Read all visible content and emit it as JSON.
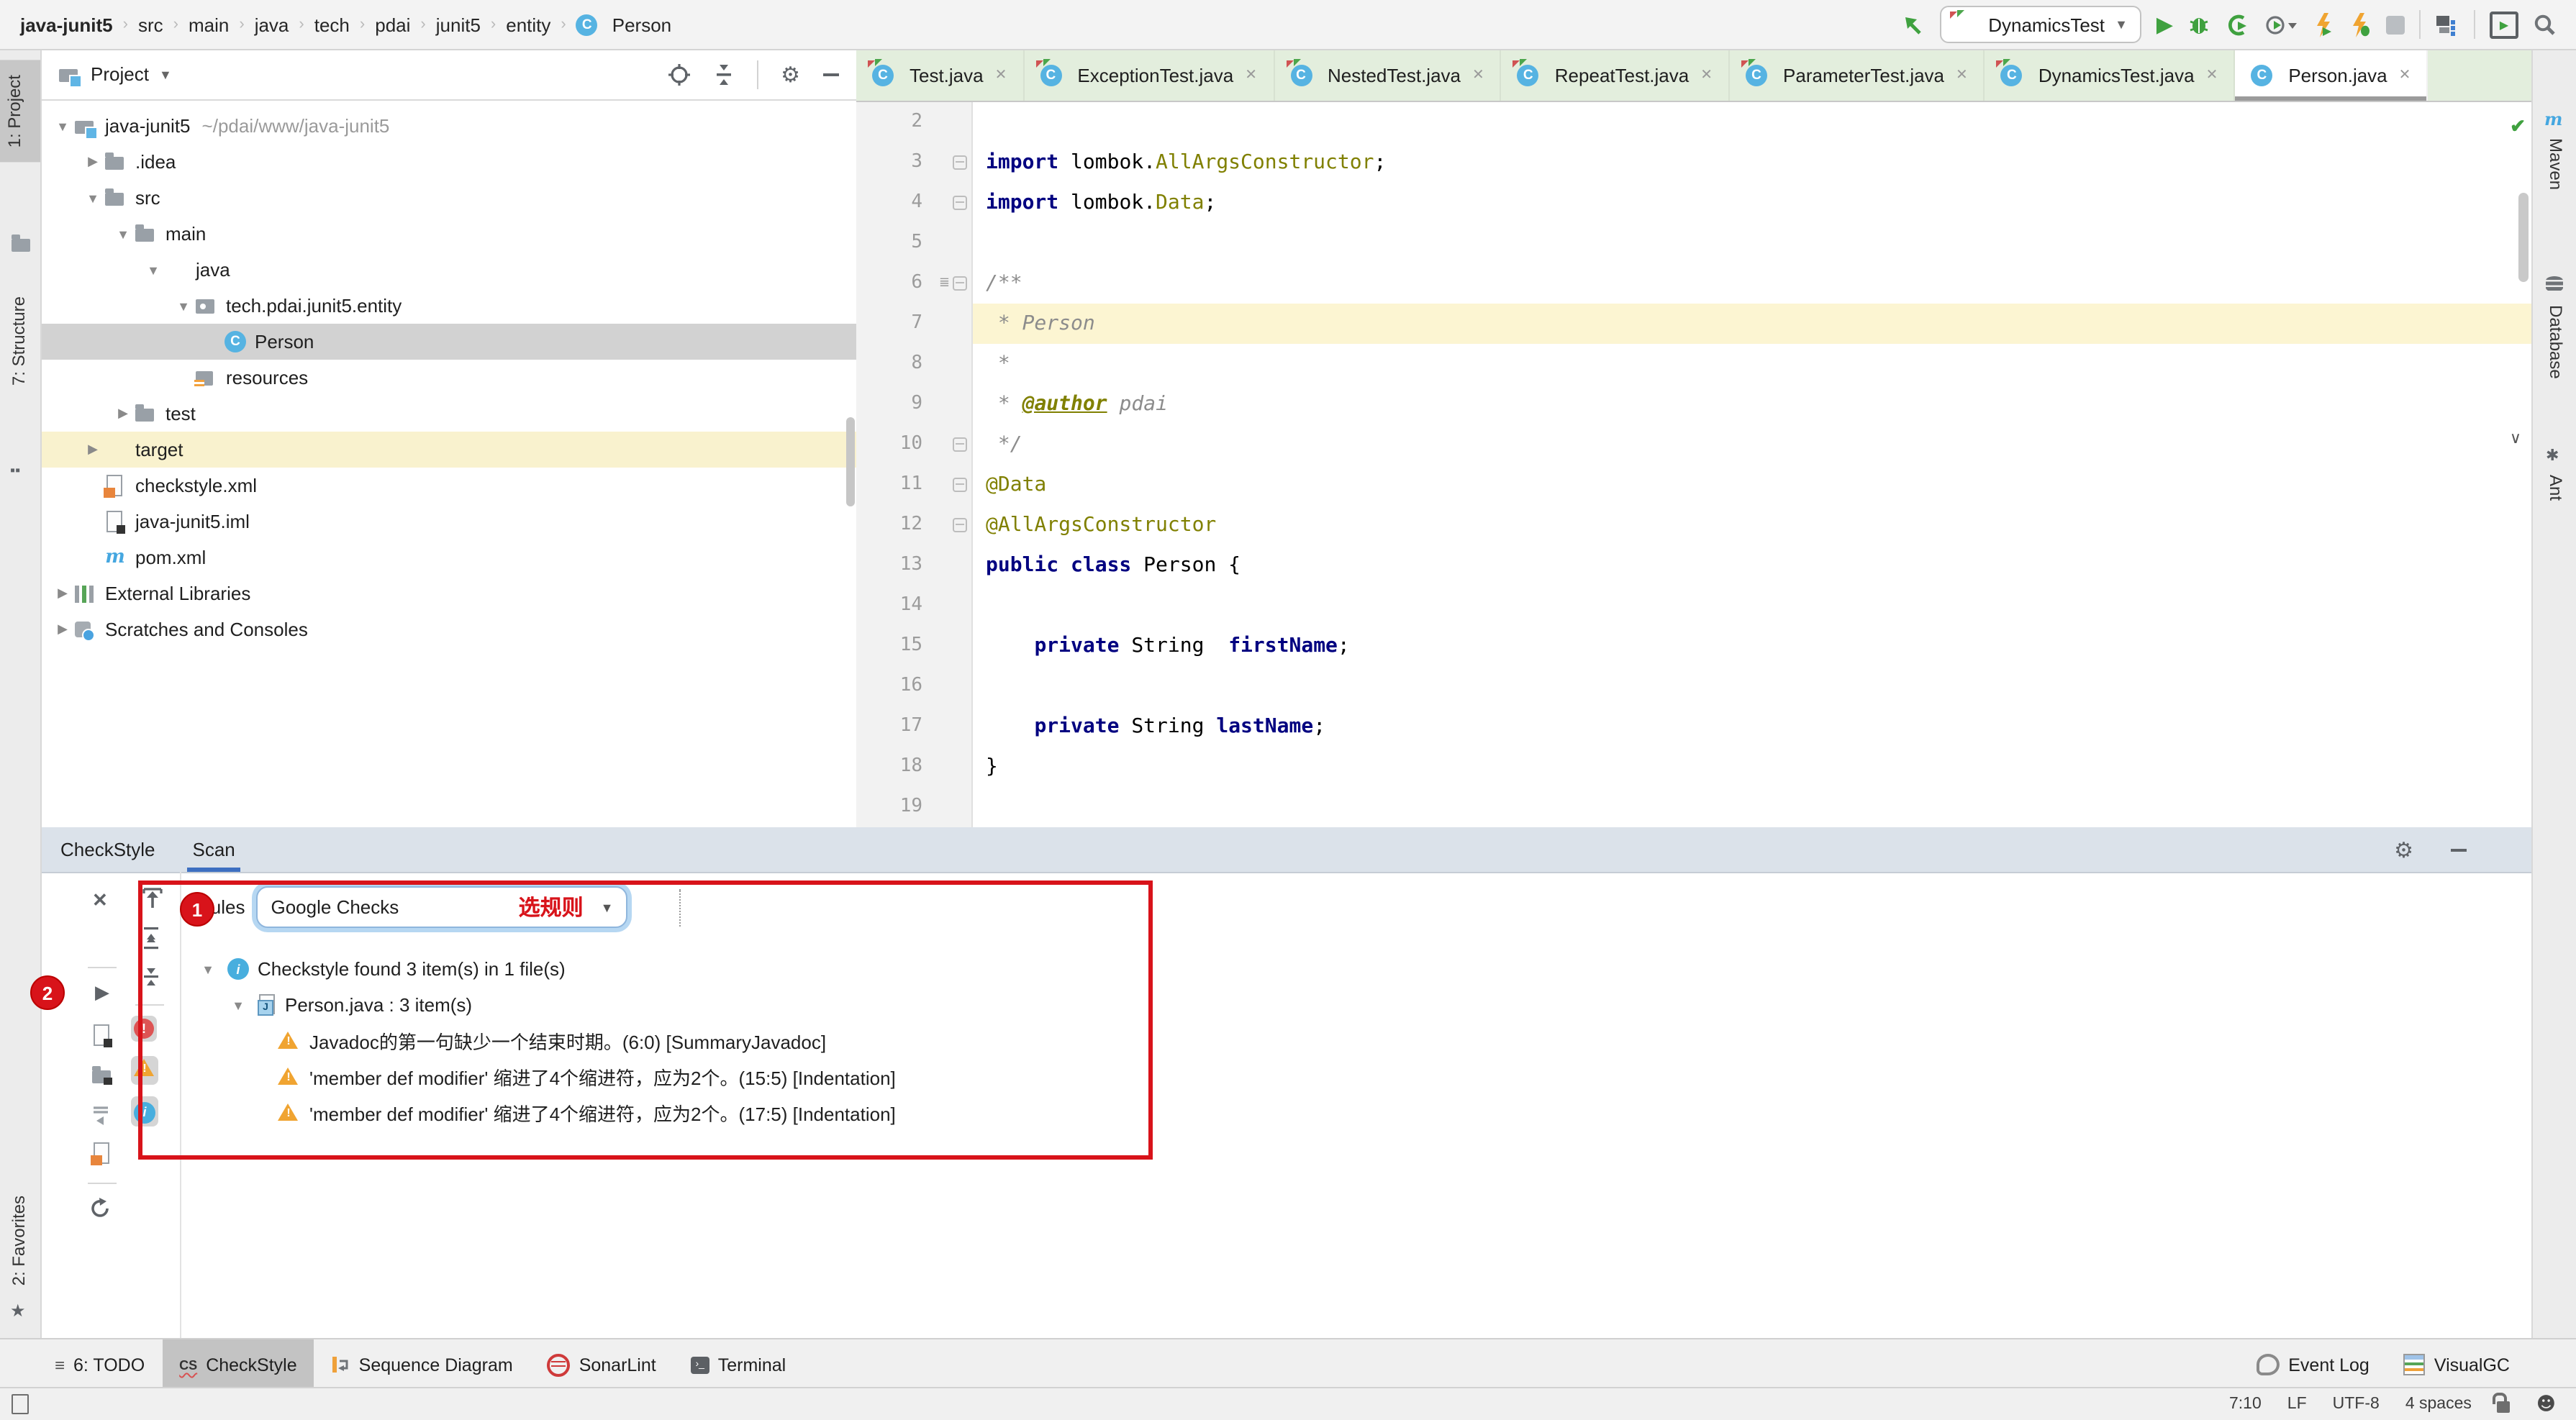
{
  "topbar": {
    "breadcrumb": [
      "java-junit5",
      "src",
      "main",
      "java",
      "tech",
      "pdai",
      "junit5",
      "entity",
      "Person"
    ],
    "run_config": "DynamicsTest"
  },
  "left_stripe": {
    "project": "1: Project",
    "structure": "7: Structure",
    "favorites": "2: Favorites"
  },
  "right_stripe": {
    "maven": "Maven",
    "database": "Database",
    "ant": "Ant"
  },
  "project_panel": {
    "title": "Project",
    "tree": [
      {
        "depth": 0,
        "icon": "project-root",
        "chevron": "down",
        "label": "java-junit5",
        "extra": "~/pdai/www/java-junit5"
      },
      {
        "depth": 1,
        "icon": "folder",
        "chevron": "right",
        "label": ".idea"
      },
      {
        "depth": 1,
        "icon": "folder",
        "chevron": "down",
        "label": "src"
      },
      {
        "depth": 2,
        "icon": "folder",
        "chevron": "down",
        "label": "main"
      },
      {
        "depth": 3,
        "icon": "folder-blue",
        "chevron": "down",
        "label": "java"
      },
      {
        "depth": 4,
        "icon": "package",
        "chevron": "down",
        "label": "tech.pdai.junit5.entity"
      },
      {
        "depth": 5,
        "icon": "class",
        "chevron": "none",
        "label": "Person",
        "selected": true
      },
      {
        "depth": 4,
        "icon": "folder-resources",
        "chevron": "none",
        "label": "resources"
      },
      {
        "depth": 2,
        "icon": "folder",
        "chevron": "right",
        "label": "test"
      },
      {
        "depth": 1,
        "icon": "folder-orange",
        "chevron": "right",
        "label": "target",
        "highlighted": true
      },
      {
        "depth": 1,
        "icon": "file-xml",
        "chevron": "none",
        "label": "checkstyle.xml"
      },
      {
        "depth": 1,
        "icon": "file-iml",
        "chevron": "none",
        "label": "java-junit5.iml"
      },
      {
        "depth": 1,
        "icon": "maven",
        "chevron": "none",
        "label": "pom.xml"
      },
      {
        "depth": 0,
        "icon": "libraries",
        "chevron": "right",
        "label": "External Libraries"
      },
      {
        "depth": 0,
        "icon": "scratches",
        "chevron": "right",
        "label": "Scratches and Consoles"
      }
    ]
  },
  "editor": {
    "tabs": [
      {
        "label": "Test.java",
        "kind": "test"
      },
      {
        "label": "ExceptionTest.java",
        "kind": "test"
      },
      {
        "label": "NestedTest.java",
        "kind": "test"
      },
      {
        "label": "RepeatTest.java",
        "kind": "test"
      },
      {
        "label": "ParameterTest.java",
        "kind": "test"
      },
      {
        "label": "DynamicsTest.java",
        "kind": "test"
      },
      {
        "label": "Person.java",
        "kind": "class",
        "active": true
      }
    ],
    "lines": [
      {
        "n": 2,
        "t": []
      },
      {
        "n": 3,
        "t": [
          [
            "kw",
            "import"
          ],
          [
            "pl",
            " lombok."
          ],
          [
            "an",
            "AllArgsConstructor"
          ],
          [
            "pl",
            ";"
          ]
        ],
        "fold": true
      },
      {
        "n": 4,
        "t": [
          [
            "kw",
            "import"
          ],
          [
            "pl",
            " lombok."
          ],
          [
            "an",
            "Data"
          ],
          [
            "pl",
            ";"
          ]
        ],
        "fold": true
      },
      {
        "n": 5,
        "t": []
      },
      {
        "n": 6,
        "t": [
          [
            "cm",
            "/**"
          ]
        ],
        "fold": true,
        "g": true
      },
      {
        "n": 7,
        "t": [
          [
            "cm",
            " * Person"
          ]
        ],
        "hl": true
      },
      {
        "n": 8,
        "t": [
          [
            "cm",
            " *"
          ]
        ]
      },
      {
        "n": 9,
        "t": [
          [
            "cm",
            " * "
          ],
          [
            "tag",
            "@author"
          ],
          [
            "cm",
            " pdai"
          ]
        ]
      },
      {
        "n": 10,
        "t": [
          [
            "cm",
            " */"
          ]
        ],
        "fold": true
      },
      {
        "n": 11,
        "t": [
          [
            "an",
            "@Data"
          ]
        ],
        "fold": true
      },
      {
        "n": 12,
        "t": [
          [
            "an",
            "@AllArgsConstructor"
          ]
        ],
        "fold": true
      },
      {
        "n": 13,
        "t": [
          [
            "kw",
            "public class"
          ],
          [
            "pl",
            " Person {"
          ]
        ]
      },
      {
        "n": 14,
        "t": []
      },
      {
        "n": 15,
        "t": [
          [
            "pl",
            "    "
          ],
          [
            "kw",
            "private"
          ],
          [
            "pl",
            " String  "
          ],
          [
            "fld",
            "firstName"
          ],
          [
            "pl",
            ";"
          ]
        ]
      },
      {
        "n": 16,
        "t": []
      },
      {
        "n": 17,
        "t": [
          [
            "pl",
            "    "
          ],
          [
            "kw",
            "private"
          ],
          [
            "pl",
            " String "
          ],
          [
            "fld",
            "lastName"
          ],
          [
            "pl",
            ";"
          ]
        ]
      },
      {
        "n": 18,
        "t": [
          [
            "pl",
            "}"
          ]
        ]
      },
      {
        "n": 19,
        "t": []
      }
    ]
  },
  "checkstyle": {
    "tab_checkstyle": "CheckStyle",
    "tab_scan": "Scan",
    "rules_label": "Rules",
    "rules_value": "Google Checks",
    "annotation_select_rule": "选规则",
    "annotation_step1": "1",
    "annotation_step2": "2",
    "summary": "Checkstyle found 3 item(s) in 1 file(s)",
    "file_row": "Person.java : 3 item(s)",
    "issues": [
      "Javadoc的第一句缺少一个结束时期。(6:0) [SummaryJavadoc]",
      "'member def modifier' 缩进了4个缩进符，应为2个。(15:5) [Indentation]",
      "'member def modifier' 缩进了4个缩进符，应为2个。(17:5) [Indentation]"
    ]
  },
  "bottom_bar": {
    "todo": "6: TODO",
    "checkstyle": "CheckStyle",
    "sequence": "Sequence Diagram",
    "sonarlint": "SonarLint",
    "terminal": "Terminal",
    "event_log": "Event Log",
    "visualgc": "VisualGC"
  },
  "status_bar": {
    "caret": "7:10",
    "line_ending": "LF",
    "encoding": "UTF-8",
    "indent": "4 spaces"
  },
  "colors": {
    "annotation_red": "#d8131a",
    "warning_orange": "#f0a431",
    "info_blue": "#48aede",
    "run_green": "#3fa13f",
    "tab_green": "#e3eedd",
    "scan_underline": "#3d6fc1"
  }
}
